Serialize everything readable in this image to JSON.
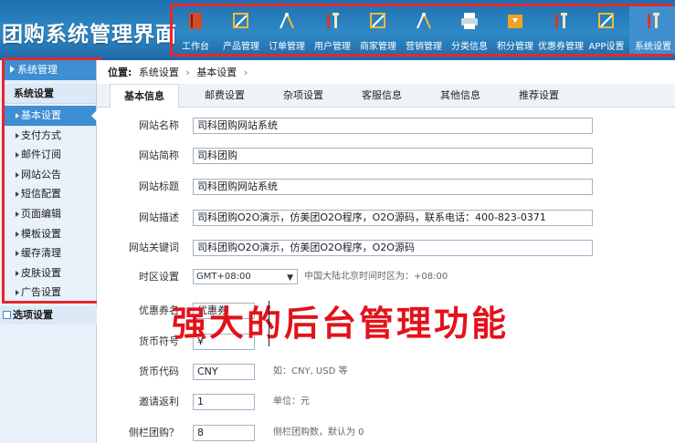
{
  "brand": "团购系统管理界面",
  "topnav": [
    {
      "label": "工作台",
      "icon": "book-icon",
      "color": "#d24a2b"
    },
    {
      "label": "产品管理",
      "icon": "pencil-ruler-icon",
      "color": "#f1b93b"
    },
    {
      "label": "订单管理",
      "icon": "compass-icon",
      "color": "#ffffff"
    },
    {
      "label": "用户管理",
      "icon": "tools-icon",
      "color": "#f4e7c0"
    },
    {
      "label": "商家管理",
      "icon": "pencil-ruler-icon",
      "color": "#f1b93b"
    },
    {
      "label": "营销管理",
      "icon": "compass-icon",
      "color": "#ffffff"
    },
    {
      "label": "分类信息",
      "icon": "printer-icon",
      "color": "#ffffff"
    },
    {
      "label": "积分管理",
      "icon": "download-box-icon",
      "color": "#f3a226"
    },
    {
      "label": "优惠券管理",
      "icon": "tools-icon",
      "color": "#f4e7c0"
    },
    {
      "label": "APP设置",
      "icon": "pencil-ruler-icon",
      "color": "#f1b93b"
    },
    {
      "label": "系统设置",
      "icon": "tools-icon",
      "color": "#f4e7c0"
    }
  ],
  "sidebar": {
    "header": "系统管理",
    "group": "系统设置",
    "items": [
      "基本设置",
      "支付方式",
      "邮件订阅",
      "网站公告",
      "短信配置",
      "页面编辑",
      "模板设置",
      "缓存清理",
      "皮肤设置",
      "广告设置"
    ],
    "group2": "选项设置"
  },
  "breadcrumb": {
    "prefix": "位置:",
    "path": [
      "系统设置",
      "基本设置"
    ],
    "trail": "›"
  },
  "tabs": [
    "基本信息",
    "邮费设置",
    "杂项设置",
    "客服信息",
    "其他信息",
    "推荐设置"
  ],
  "form": {
    "site_name": {
      "label": "网站名称",
      "value": "司科团购网站系统"
    },
    "site_short": {
      "label": "网站简称",
      "value": "司科团购"
    },
    "site_title": {
      "label": "网站标题",
      "value": "司科团购网站系统"
    },
    "site_desc": {
      "label": "网站描述",
      "value": "司科团购O2O演示，仿美团O2O程序，O2O源码，联系电话：400-823-0371"
    },
    "site_keywords": {
      "label": "网站关键词",
      "value": "司科团购O2O演示，仿美团O2O程序，O2O源码"
    },
    "timezone": {
      "label": "时区设置",
      "value": "GMT+08:00",
      "hint": "中国大陆北京时间时区为：+08:00"
    },
    "coupon": {
      "label": "优惠券名",
      "value": "优惠券"
    },
    "currency_symbol": {
      "label": "货币符号",
      "value": "¥"
    },
    "currency_code": {
      "label": "货币代码",
      "value": "CNY",
      "hint": "如：CNY, USD 等"
    },
    "invite_rebate": {
      "label": "邀请返利",
      "value": "1",
      "hint": "单位：元"
    },
    "sidebar_deals": {
      "label": "侧栏团购？",
      "value": "8",
      "hint": "侧栏团购数，默认为 0"
    }
  },
  "overlay_text": "强大的后台管理功能",
  "colors": {
    "accent": "#3d8ed2",
    "header": "#1f6fae",
    "highlight": "#e8262d"
  }
}
